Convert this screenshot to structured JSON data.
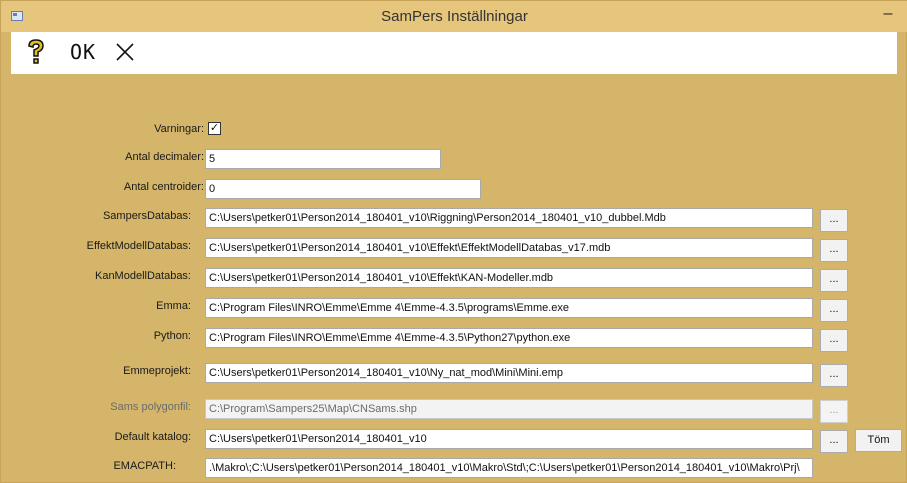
{
  "window": {
    "title": "SamPers Inställningar",
    "minimize_glyph": "–"
  },
  "toolbar": {
    "ok_label": "OK"
  },
  "settings": {
    "varningar": {
      "label": "Varningar:",
      "checked": true,
      "check_glyph": "✓"
    },
    "antal_decimaler": {
      "label": "Antal decimaler:",
      "value": "5"
    },
    "antal_centroider": {
      "label": "Antal centroider:",
      "value": "0"
    },
    "sampers_databas": {
      "label": "SampersDatabas:",
      "value": "C:\\Users\\petker01\\Person2014_180401_v10\\Riggning\\Person2014_180401_v10_dubbel.Mdb"
    },
    "effekt_modell_databas": {
      "label": "EffektModellDatabas:",
      "value": "C:\\Users\\petker01\\Person2014_180401_v10\\Effekt\\EffektModellDatabas_v17.mdb"
    },
    "kan_modell_databas": {
      "label": "KanModellDatabas:",
      "value": "C:\\Users\\petker01\\Person2014_180401_v10\\Effekt\\KAN-Modeller.mdb"
    },
    "emma": {
      "label": "Emma:",
      "value": "C:\\Program Files\\INRO\\Emme\\Emme 4\\Emme-4.3.5\\programs\\Emme.exe"
    },
    "python": {
      "label": "Python:",
      "value": "C:\\Program Files\\INRO\\Emme\\Emme 4\\Emme-4.3.5\\Python27\\python.exe"
    },
    "emmeprojekt": {
      "label": "Emmeprojekt:",
      "value": "C:\\Users\\petker01\\Person2014_180401_v10\\Ny_nat_mod\\Mini\\Mini.emp"
    },
    "sams_polygonfil": {
      "label": "Sams polygonfil:",
      "value": "C:\\Program\\Sampers25\\Map\\CNSams.shp"
    },
    "default_katalog": {
      "label": "Default katalog:",
      "value": "C:\\Users\\petker01\\Person2014_180401_v10"
    },
    "emacpath": {
      "label": "EMACPATH:",
      "value": ".\\Makro\\;C:\\Users\\petker01\\Person2014_180401_v10\\Makro\\Std\\;C:\\Users\\petker01\\Person2014_180401_v10\\Makro\\Prj\\"
    }
  },
  "buttons": {
    "browse_label": "...",
    "tom_label": "Töm"
  },
  "colors": {
    "window_bg": "#d4b56a",
    "titlebar_bg": "#e6c57c",
    "toolbar_bg": "#ffffff",
    "help_icon": "#e0c020"
  }
}
